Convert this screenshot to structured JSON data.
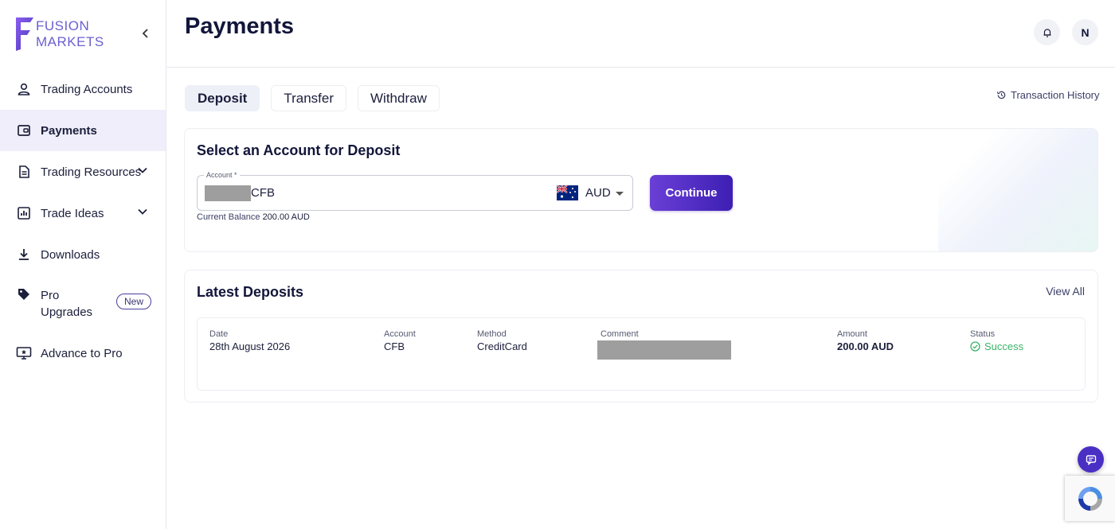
{
  "brand": {
    "line1": "FUSION",
    "line2": "MARKETS"
  },
  "sidebar": {
    "items": [
      {
        "label": "Trading Accounts",
        "icon": "user-icon"
      },
      {
        "label": "Payments",
        "icon": "wallet-icon",
        "active": true
      },
      {
        "label": "Trading Resources",
        "icon": "document-icon"
      },
      {
        "label": "Trade Ideas",
        "icon": "chart-icon"
      },
      {
        "label": "Downloads",
        "icon": "download-icon"
      },
      {
        "label": "Pro Upgrades",
        "icon": "tag-icon",
        "badge": "New"
      },
      {
        "label": "Advance to Pro",
        "icon": "monitor-star-icon"
      }
    ]
  },
  "header": {
    "title": "Payments",
    "avatar_initial": "N"
  },
  "tabs": [
    {
      "label": "Deposit",
      "active": true
    },
    {
      "label": "Transfer"
    },
    {
      "label": "Withdraw"
    }
  ],
  "transaction_history": "Transaction History",
  "deposit": {
    "title": "Select an Account for Deposit",
    "account_label": "Account *",
    "account_value": "CFB",
    "currency": "AUD",
    "balance_label": "Current Balance",
    "balance_value": "200.00 AUD",
    "continue_label": "Continue"
  },
  "latest": {
    "title": "Latest Deposits",
    "view_all": "View All",
    "headers": {
      "date": "Date",
      "account": "Account",
      "method": "Method",
      "comment": "Comment",
      "amount": "Amount",
      "status": "Status"
    },
    "row": {
      "date": "28th August 2026",
      "account": "CFB",
      "method": "CreditCard",
      "amount": "200.00 AUD",
      "status": "Success"
    }
  },
  "colors": {
    "accent": "#4a2fc4",
    "success": "#3bb36a",
    "active_bg": "#f0eefb"
  }
}
